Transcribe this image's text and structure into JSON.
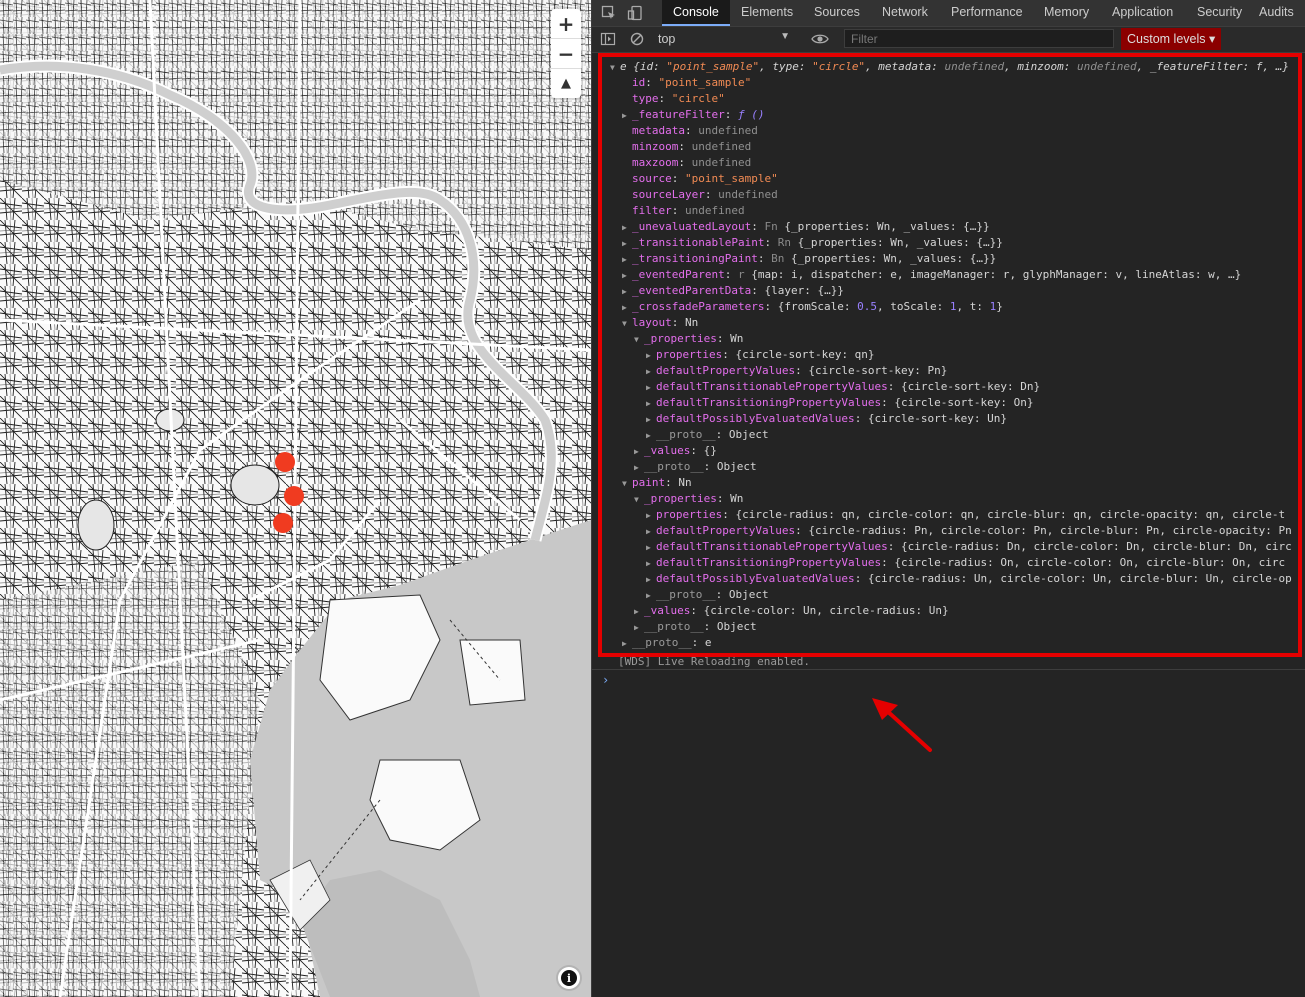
{
  "map": {
    "zoom_in": "+",
    "zoom_out": "−",
    "compass": "▲",
    "attribution": "i",
    "marker_color": "#f03b20",
    "markers_count": 3
  },
  "devtools": {
    "tabs": [
      "Console",
      "Elements",
      "Sources",
      "Network",
      "Performance",
      "Memory",
      "Application",
      "Security",
      "Audits"
    ],
    "active_tab": "Console",
    "context": "top",
    "filter_placeholder": "Filter",
    "levels": "Custom levels ▾",
    "console_lines": [
      {
        "indent": 0,
        "tri": "▼",
        "segs": [
          [
            "it p",
            "e "
          ],
          [
            "it p",
            "{id: "
          ],
          [
            "it s",
            "\"point_sample\""
          ],
          [
            "it p",
            ", type: "
          ],
          [
            "it s",
            "\"circle\""
          ],
          [
            "it p",
            ", metadata: "
          ],
          [
            "it u",
            "undefined"
          ],
          [
            "it p",
            ", minzoom: "
          ],
          [
            "it u",
            "undefined"
          ],
          [
            "it p",
            ", _featureFilter: f, …}"
          ]
        ]
      },
      {
        "indent": 1,
        "tri": "",
        "segs": [
          [
            "k",
            "id"
          ],
          [
            "p",
            ": "
          ],
          [
            "s",
            "\"point_sample\""
          ]
        ]
      },
      {
        "indent": 1,
        "tri": "",
        "segs": [
          [
            "k",
            "type"
          ],
          [
            "p",
            ": "
          ],
          [
            "s",
            "\"circle\""
          ]
        ]
      },
      {
        "indent": 1,
        "tri": "▶",
        "segs": [
          [
            "k",
            "_featureFilter"
          ],
          [
            "p",
            ": "
          ],
          [
            "fn",
            "ƒ ()"
          ]
        ]
      },
      {
        "indent": 1,
        "tri": "",
        "segs": [
          [
            "k",
            "metadata"
          ],
          [
            "p",
            ": "
          ],
          [
            "u",
            "undefined"
          ]
        ]
      },
      {
        "indent": 1,
        "tri": "",
        "segs": [
          [
            "k",
            "minzoom"
          ],
          [
            "p",
            ": "
          ],
          [
            "u",
            "undefined"
          ]
        ]
      },
      {
        "indent": 1,
        "tri": "",
        "segs": [
          [
            "k",
            "maxzoom"
          ],
          [
            "p",
            ": "
          ],
          [
            "u",
            "undefined"
          ]
        ]
      },
      {
        "indent": 1,
        "tri": "",
        "segs": [
          [
            "k",
            "source"
          ],
          [
            "p",
            ": "
          ],
          [
            "s",
            "\"point_sample\""
          ]
        ]
      },
      {
        "indent": 1,
        "tri": "",
        "segs": [
          [
            "k",
            "sourceLayer"
          ],
          [
            "p",
            ": "
          ],
          [
            "u",
            "undefined"
          ]
        ]
      },
      {
        "indent": 1,
        "tri": "",
        "segs": [
          [
            "k",
            "filter"
          ],
          [
            "p",
            ": "
          ],
          [
            "u",
            "undefined"
          ]
        ]
      },
      {
        "indent": 1,
        "tri": "▶",
        "segs": [
          [
            "k",
            "_unevaluatedLayout"
          ],
          [
            "p",
            ": "
          ],
          [
            "gray",
            "Fn "
          ],
          [
            "p",
            "{_properties: Wn, _values: {…}}"
          ]
        ]
      },
      {
        "indent": 1,
        "tri": "▶",
        "segs": [
          [
            "k",
            "_transitionablePaint"
          ],
          [
            "p",
            ": "
          ],
          [
            "gray",
            "Rn "
          ],
          [
            "p",
            "{_properties: Wn, _values: {…}}"
          ]
        ]
      },
      {
        "indent": 1,
        "tri": "▶",
        "segs": [
          [
            "k",
            "_transitioningPaint"
          ],
          [
            "p",
            ": "
          ],
          [
            "gray",
            "Bn "
          ],
          [
            "p",
            "{_properties: Wn, _values: {…}}"
          ]
        ]
      },
      {
        "indent": 1,
        "tri": "▶",
        "segs": [
          [
            "k",
            "_eventedParent"
          ],
          [
            "p",
            ": "
          ],
          [
            "gray",
            "r "
          ],
          [
            "p",
            "{map: i, dispatcher: e, imageManager: r, glyphManager: v, lineAtlas: w, …}"
          ]
        ]
      },
      {
        "indent": 1,
        "tri": "▶",
        "segs": [
          [
            "k",
            "_eventedParentData"
          ],
          [
            "p",
            ": {layer: {…}}"
          ]
        ]
      },
      {
        "indent": 1,
        "tri": "▶",
        "segs": [
          [
            "k",
            "_crossfadeParameters"
          ],
          [
            "p",
            ": {fromScale: "
          ],
          [
            "n",
            "0.5"
          ],
          [
            "p",
            ", toScale: "
          ],
          [
            "n",
            "1"
          ],
          [
            "p",
            ", t: "
          ],
          [
            "n",
            "1"
          ],
          [
            "p",
            "}"
          ]
        ]
      },
      {
        "indent": 1,
        "tri": "▼",
        "segs": [
          [
            "k",
            "layout"
          ],
          [
            "p",
            ": Nn"
          ]
        ]
      },
      {
        "indent": 2,
        "tri": "▼",
        "segs": [
          [
            "k",
            "_properties"
          ],
          [
            "p",
            ": Wn"
          ]
        ]
      },
      {
        "indent": 3,
        "tri": "▶",
        "segs": [
          [
            "k",
            "properties"
          ],
          [
            "p",
            ": {circle-sort-key: qn}"
          ]
        ]
      },
      {
        "indent": 3,
        "tri": "▶",
        "segs": [
          [
            "k",
            "defaultPropertyValues"
          ],
          [
            "p",
            ": {circle-sort-key: Pn}"
          ]
        ]
      },
      {
        "indent": 3,
        "tri": "▶",
        "segs": [
          [
            "k",
            "defaultTransitionablePropertyValues"
          ],
          [
            "p",
            ": {circle-sort-key: Dn}"
          ]
        ]
      },
      {
        "indent": 3,
        "tri": "▶",
        "segs": [
          [
            "k",
            "defaultTransitioningPropertyValues"
          ],
          [
            "p",
            ": {circle-sort-key: On}"
          ]
        ]
      },
      {
        "indent": 3,
        "tri": "▶",
        "segs": [
          [
            "k",
            "defaultPossiblyEvaluatedValues"
          ],
          [
            "p",
            ": {circle-sort-key: Un}"
          ]
        ]
      },
      {
        "indent": 3,
        "tri": "▶",
        "segs": [
          [
            "ks",
            "__proto__"
          ],
          [
            "p",
            ": Object"
          ]
        ]
      },
      {
        "indent": 2,
        "tri": "▶",
        "segs": [
          [
            "k",
            "_values"
          ],
          [
            "p",
            ": {}"
          ]
        ]
      },
      {
        "indent": 2,
        "tri": "▶",
        "segs": [
          [
            "ks",
            "__proto__"
          ],
          [
            "p",
            ": Object"
          ]
        ]
      },
      {
        "indent": 1,
        "tri": "▼",
        "segs": [
          [
            "k",
            "paint"
          ],
          [
            "p",
            ": Nn"
          ]
        ]
      },
      {
        "indent": 2,
        "tri": "▼",
        "segs": [
          [
            "k",
            "_properties"
          ],
          [
            "p",
            ": Wn"
          ]
        ]
      },
      {
        "indent": 3,
        "tri": "▶",
        "segs": [
          [
            "k",
            "properties"
          ],
          [
            "p",
            ": {circle-radius: qn, circle-color: qn, circle-blur: qn, circle-opacity: qn, circle-t"
          ]
        ]
      },
      {
        "indent": 3,
        "tri": "▶",
        "segs": [
          [
            "k",
            "defaultPropertyValues"
          ],
          [
            "p",
            ": {circle-radius: Pn, circle-color: Pn, circle-blur: Pn, circle-opacity: Pn"
          ]
        ]
      },
      {
        "indent": 3,
        "tri": "▶",
        "segs": [
          [
            "k",
            "defaultTransitionablePropertyValues"
          ],
          [
            "p",
            ": {circle-radius: Dn, circle-color: Dn, circle-blur: Dn, circ"
          ]
        ]
      },
      {
        "indent": 3,
        "tri": "▶",
        "segs": [
          [
            "k",
            "defaultTransitioningPropertyValues"
          ],
          [
            "p",
            ": {circle-radius: On, circle-color: On, circle-blur: On, circ"
          ]
        ]
      },
      {
        "indent": 3,
        "tri": "▶",
        "segs": [
          [
            "k",
            "defaultPossiblyEvaluatedValues"
          ],
          [
            "p",
            ": {circle-radius: Un, circle-color: Un, circle-blur: Un, circle-op"
          ]
        ]
      },
      {
        "indent": 3,
        "tri": "▶",
        "segs": [
          [
            "ks",
            "__proto__"
          ],
          [
            "p",
            ": Object"
          ]
        ]
      },
      {
        "indent": 2,
        "tri": "▶",
        "segs": [
          [
            "k",
            "_values"
          ],
          [
            "p",
            ": {circle-color: Un, circle-radius: Un}"
          ]
        ]
      },
      {
        "indent": 2,
        "tri": "▶",
        "segs": [
          [
            "ks",
            "__proto__"
          ],
          [
            "p",
            ": Object"
          ]
        ]
      },
      {
        "indent": 1,
        "tri": "▶",
        "segs": [
          [
            "ks",
            "__proto__"
          ],
          [
            "p",
            ": e"
          ]
        ]
      }
    ],
    "wds_message": "[WDS] Live Reloading enabled.",
    "prompt": "›",
    "highlight_color": "#e50000"
  }
}
